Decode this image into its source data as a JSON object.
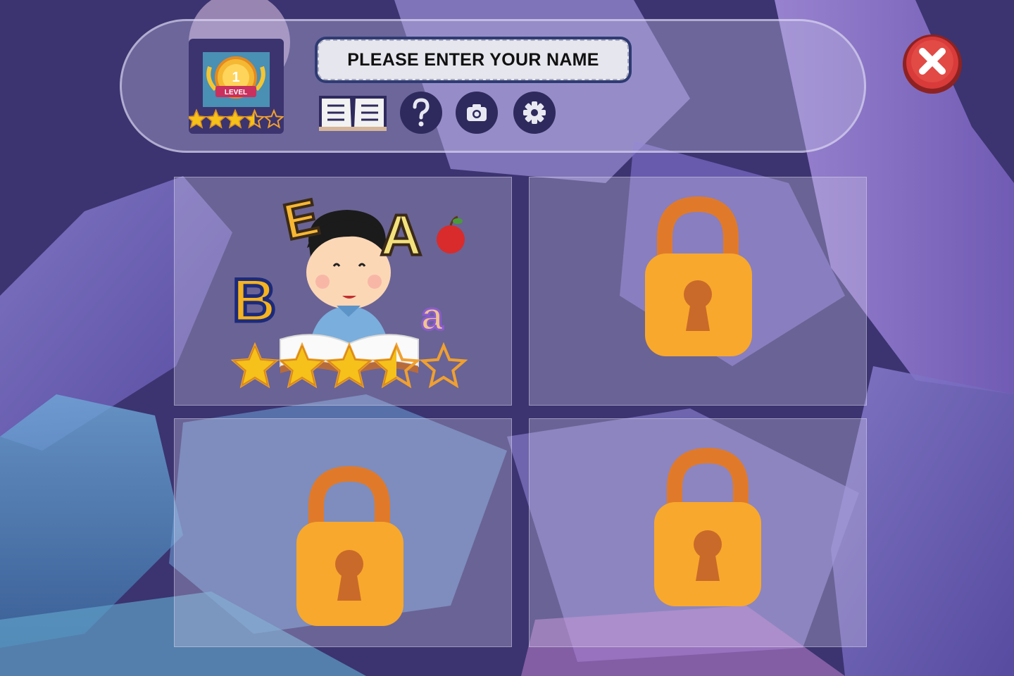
{
  "player": {
    "level_number": "1",
    "level_caption": "LEVEL",
    "rating": 3.5,
    "rating_max": 5,
    "name_prompt": "PLEASE ENTER YOUR NAME"
  },
  "toolbar": {
    "icons": [
      "book-icon",
      "help-icon",
      "camera-icon",
      "settings-icon"
    ]
  },
  "close_icon": "close-icon",
  "levels": [
    {
      "status": "unlocked",
      "letters": [
        "E",
        "A",
        "B",
        "a"
      ],
      "rating": 3.5,
      "rating_max": 5
    },
    {
      "status": "locked",
      "icon": "lock-icon"
    },
    {
      "status": "locked",
      "icon": "lock-icon"
    },
    {
      "status": "locked",
      "icon": "lock-icon"
    }
  ],
  "colors": {
    "background": "#3b3470",
    "star_gold": "#f5c11a",
    "lock_body": "#f8a82c",
    "lock_shackle": "#e07a2a",
    "close_red": "#d93a3a"
  }
}
